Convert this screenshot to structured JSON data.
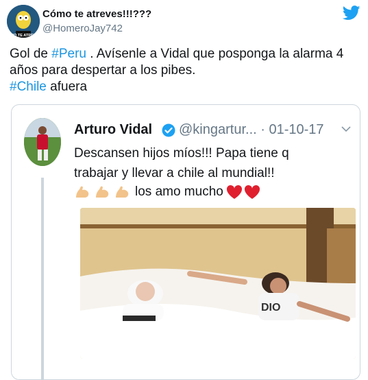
{
  "tweet": {
    "display_name": "Cómo te atreves!!!???",
    "handle": "@HomeroJay742",
    "avatar_caption": "MO TE ATREV",
    "text_part1": "Gol de ",
    "hashtag1": "#Peru",
    "text_part2": " . Avísenle a Vidal que posponga la alarma 4 años para despertar a los pibes.",
    "hashtag2": "#Chile",
    "text_part3": " afuera"
  },
  "quoted": {
    "display_name": "Arturo Vidal",
    "handle_date": "@kingartur... · 01-10-17",
    "line1": "Descansen hijos míos!!! Papa tiene q",
    "line2": "trabajar y llevar a chile al mundial!!",
    "line3": "los amo mucho",
    "shirt_text": "DIO"
  },
  "colors": {
    "hashtag": "#1b95e0",
    "secondary_text": "#657786",
    "border": "#ccd6dd",
    "twitter_blue": "#1da1f2"
  }
}
